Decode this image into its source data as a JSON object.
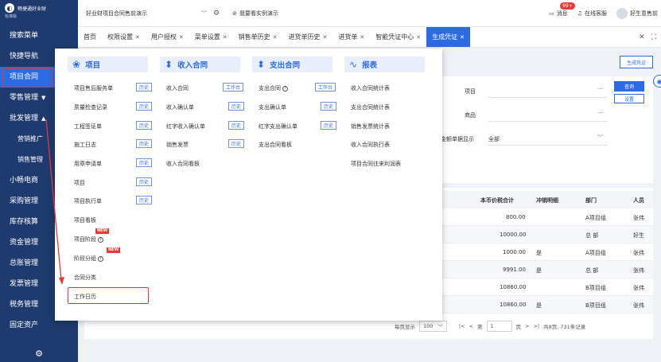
{
  "logo": {
    "name": "畅捷通好业财",
    "sub": "标准版"
  },
  "sidebar": {
    "items": [
      {
        "label": "搜索菜单"
      },
      {
        "label": "快捷导航"
      },
      {
        "label": "项目合同"
      },
      {
        "label": "零售管理"
      },
      {
        "label": "批发管理"
      },
      {
        "label": "营销推广"
      },
      {
        "label": "销售管理"
      },
      {
        "label": "小畅电商"
      },
      {
        "label": "采购管理"
      },
      {
        "label": "库存核算"
      },
      {
        "label": "资金管理"
      },
      {
        "label": "总账管理"
      },
      {
        "label": "发票管理"
      },
      {
        "label": "税务管理"
      },
      {
        "label": "固定资产"
      }
    ],
    "caret_down": "▼",
    "caret_up": "▲"
  },
  "topbar": {
    "company": "好业财项目合同售前演示",
    "demo_link": "我要看实例演示",
    "messages": "消息",
    "badge": "99+",
    "service": "在线客服",
    "user": "好生意售前"
  },
  "tabs": [
    {
      "label": "首页",
      "closable": false
    },
    {
      "label": "权限设置",
      "closable": true
    },
    {
      "label": "用户授权",
      "closable": true
    },
    {
      "label": "菜单设置",
      "closable": true
    },
    {
      "label": "销售单历史",
      "closable": true
    },
    {
      "label": "进货单历史",
      "closable": true
    },
    {
      "label": "进货单",
      "closable": true
    },
    {
      "label": "智能凭证中心",
      "closable": true
    },
    {
      "label": "生成凭证",
      "closable": true,
      "active": true
    }
  ],
  "content": {
    "gen_button": "生成凭证",
    "project_label": "项目",
    "goods_label": "商品",
    "amount_label": "金额单据显示",
    "amount_value": "全部",
    "query": "查询",
    "settings": "设置",
    "table": {
      "headers": [
        "本币价税合计",
        "冲销明细",
        "部门",
        "人员"
      ],
      "rows": [
        {
          "amount": "800.00",
          "offset": "",
          "dept": "A项目组",
          "person": "张伟"
        },
        {
          "amount": "10000.00",
          "offset": "",
          "dept": "总 部",
          "person": "好生"
        },
        {
          "amount": "1000.00",
          "offset": "是",
          "dept": "A项目组",
          "person": "张伟"
        },
        {
          "amount": "9991.00",
          "offset": "是",
          "dept": "总 部",
          "person": "张伟"
        },
        {
          "amount": "10860.00",
          "offset": "",
          "dept": "B项目组",
          "person": "张伟"
        },
        {
          "amount": "10860.00",
          "offset": "是",
          "dept": "B项目组",
          "person": "张伟"
        }
      ]
    },
    "pager": {
      "per_page_label": "每页显示",
      "per_page": "100",
      "page_prefix": "第",
      "page": "1",
      "page_suffix": "页",
      "summary": "共8页, 731条记录"
    }
  },
  "menu": {
    "history_label": "历史",
    "contract_label": "工作台",
    "new_label": "NEW",
    "columns": [
      {
        "title": "项目",
        "icon": "project-icon"
      },
      {
        "title": "收入合同",
        "icon": "income-contract-icon"
      },
      {
        "title": "支出合同",
        "icon": "expense-contract-icon"
      },
      {
        "title": "报表",
        "icon": "report-icon"
      }
    ],
    "project_items": [
      "项目售后服务单",
      "质量检查记录",
      "工程签证单",
      "施工日志",
      "用章申请单",
      "项目",
      "项目执行单",
      "项目看板",
      "项目阶段",
      "阶段分组",
      "合同分类",
      "工作日历"
    ],
    "income_items": [
      "收入合同",
      "收入确认单",
      "红字收入确认单",
      "销售发票",
      "收入合同看板"
    ],
    "expense_items": [
      "支出合同",
      "支出确认单",
      "红字支出确认单",
      "支出合同看板"
    ],
    "report_items": [
      "收入合同统计表",
      "支出合同统计表",
      "销售发票统计表",
      "收入合同执行表",
      "项目合同往来利润表"
    ]
  },
  "colors": {
    "sidebar": "#1f3a6e",
    "accent": "#2d6be4",
    "highlight": "#e53935"
  }
}
